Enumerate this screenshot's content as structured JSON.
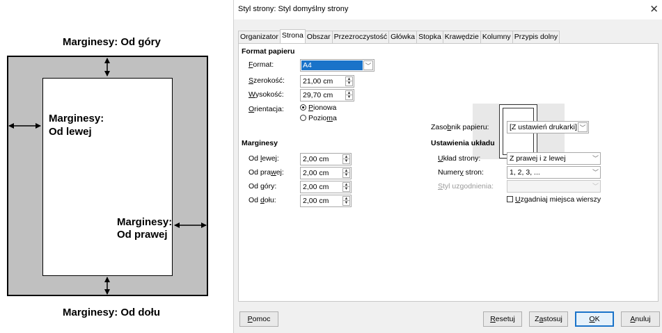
{
  "diagram": {
    "top_label": "Marginesy: Od góry",
    "left_label_line1": "Marginesy:",
    "left_label_line2": "Od lewej",
    "right_label_line1": "Marginesy:",
    "right_label_line2": "Od prawej",
    "bottom_label": "Marginesy: Od dołu"
  },
  "dialog": {
    "title": "Styl strony: Styl domyślny strony",
    "close_icon": "close-icon",
    "tabs": [
      "Organizator",
      "Strona",
      "Obszar",
      "Przezroczystość",
      "Główka",
      "Stopka",
      "Krawędzie",
      "Kolumny",
      "Przypis dolny"
    ],
    "active_tab": "Strona",
    "paper_format": {
      "heading": "Format papieru",
      "format_label": "Format:",
      "format_value": "A4",
      "width_label": "Szerokość:",
      "width_value": "21,00 cm",
      "height_label": "Wysokość:",
      "height_value": "29,70 cm",
      "orientation_label": "Orientacja:",
      "portrait": "Pionowa",
      "landscape": "Pozioma",
      "orientation_selected": "Pionowa",
      "tray_label": "Zasobnik papieru:",
      "tray_value": "[Z ustawień drukarki]"
    },
    "margins": {
      "heading": "Marginesy",
      "left_label": "Od lewej:",
      "left_value": "2,00 cm",
      "right_label": "Od prawej:",
      "right_value": "2,00 cm",
      "top_label": "Od góry:",
      "top_value": "2,00 cm",
      "bottom_label": "Od dołu:",
      "bottom_value": "2,00 cm"
    },
    "layout": {
      "heading": "Ustawienia układu",
      "page_layout_label": "Układ strony:",
      "page_layout_value": "Z prawej i z lewej",
      "numbering_label": "Numery stron:",
      "numbering_value": "1, 2, 3, ...",
      "reference_style_label": "Styl uzgodnienia:",
      "reference_style_value": "",
      "register_true_label": "Uzgadniaj miejsca wierszy",
      "register_true_checked": false
    },
    "buttons": {
      "help": "Pomoc",
      "reset": "Resetuj",
      "apply": "Zastosuj",
      "ok": "OK",
      "cancel": "Anuluj"
    }
  }
}
